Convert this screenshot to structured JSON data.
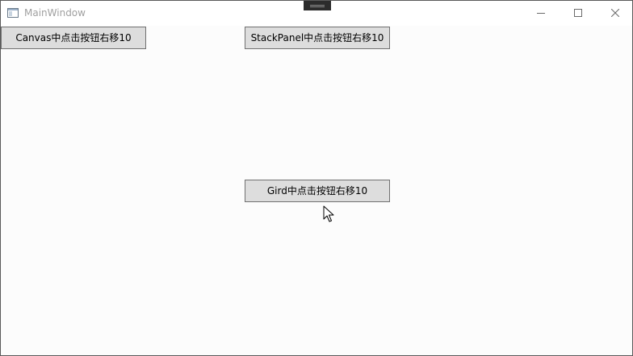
{
  "window": {
    "title": "MainWindow",
    "icon": "app-window-icon"
  },
  "caption_buttons": {
    "minimize_icon": "minimize-icon",
    "maximize_icon": "maximize-icon",
    "close_icon": "close-icon"
  },
  "buttons": {
    "canvas_label": "Canvas中点击按钮右移10",
    "stackpanel_label": "StackPanel中点击按钮右移10",
    "grid_label": "Gird中点击按钮右移10"
  },
  "colors": {
    "button_bg": "#dddddd",
    "button_border": "#707070",
    "title_text": "#a0a0a0",
    "client_bg": "#fcfcfc"
  }
}
